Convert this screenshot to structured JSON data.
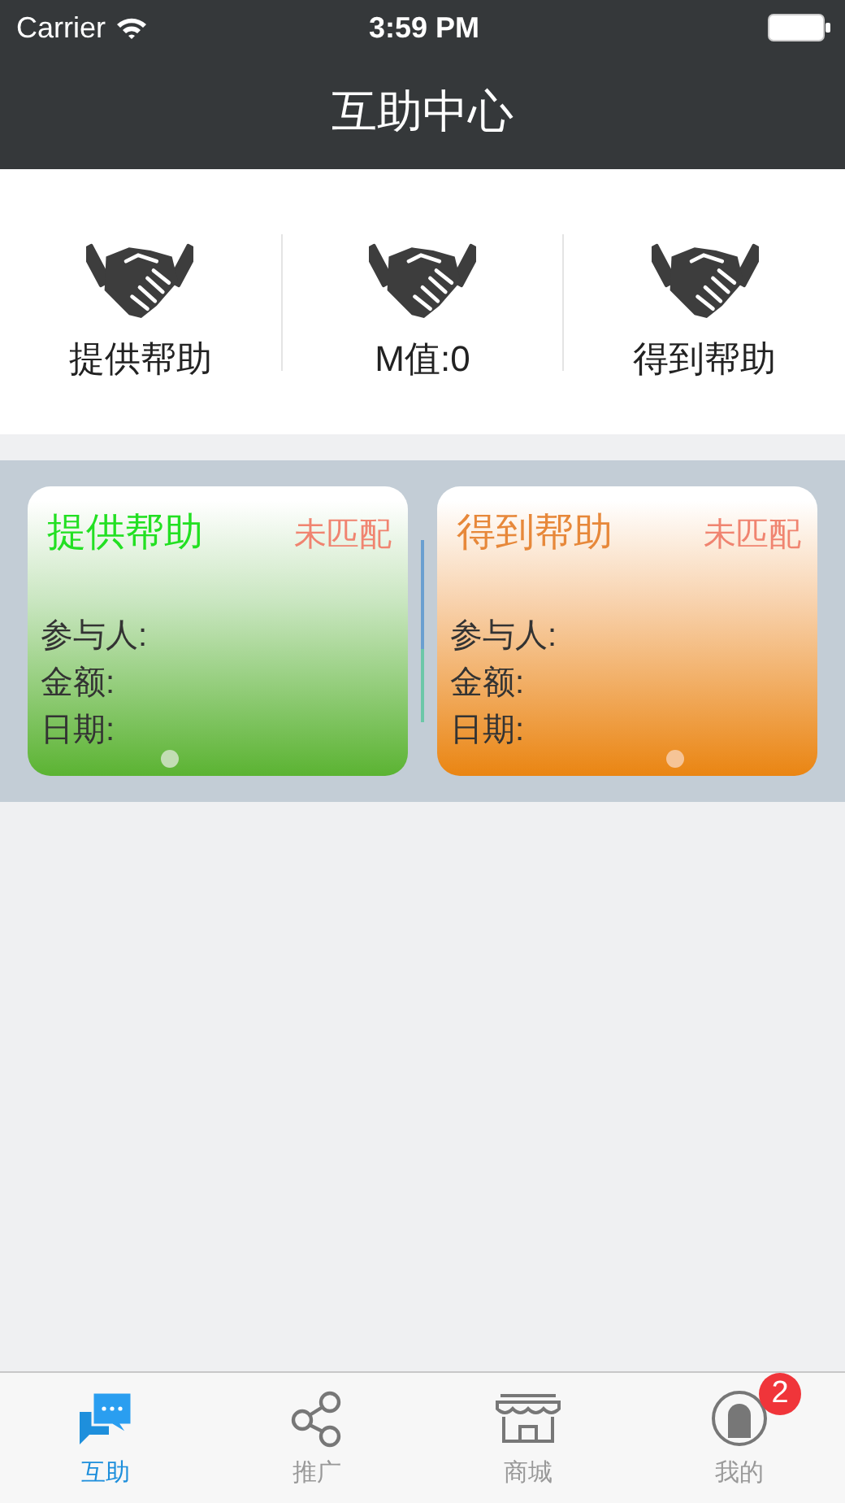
{
  "status_bar": {
    "carrier": "Carrier",
    "time": "3:59 PM"
  },
  "nav": {
    "title": "互助中心"
  },
  "actions": [
    {
      "label": "提供帮助"
    },
    {
      "label": "M值:0"
    },
    {
      "label": "得到帮助"
    }
  ],
  "cards": [
    {
      "kind": "give",
      "title": "提供帮助",
      "status": "未匹配",
      "fields": [
        "参与人:",
        "金额:",
        "日期:"
      ]
    },
    {
      "kind": "get",
      "title": "得到帮助",
      "status": "未匹配",
      "fields": [
        "参与人:",
        "金额:",
        "日期:"
      ]
    }
  ],
  "tabs": [
    {
      "kind": "chat",
      "label": "互助",
      "selected": true
    },
    {
      "kind": "share",
      "label": "推广",
      "selected": false
    },
    {
      "kind": "shop",
      "label": "商城",
      "selected": false
    },
    {
      "kind": "user",
      "label": "我的",
      "selected": false,
      "badge": "2"
    }
  ]
}
